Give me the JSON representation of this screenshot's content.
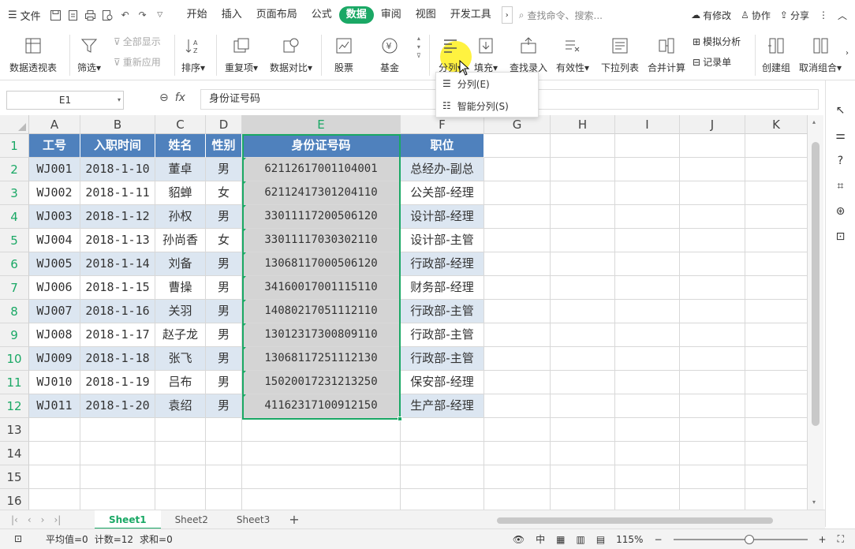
{
  "menubar": {
    "file_label": "文件",
    "tabs": [
      "开始",
      "插入",
      "页面布局",
      "公式",
      "数据",
      "审阅",
      "视图",
      "开发工具"
    ],
    "active_tab": "数据",
    "search_placeholder": "查找命令、搜索...",
    "right": {
      "modify": "有修改",
      "collab": "协作",
      "share": "分享"
    }
  },
  "ribbon": {
    "pivot": "数据透视表",
    "filter": "筛选",
    "show_all": "全部显示",
    "reapply": "重新应用",
    "sort": "排序",
    "dup": "重复项",
    "compare": "数据对比",
    "stock": "股票",
    "fund": "基金",
    "split": "分列",
    "fill": "填充",
    "lookup": "查找录入",
    "validity": "有效性",
    "dropdown_list": "下拉列表",
    "merge_calc": "合并计算",
    "simulate": "模拟分析",
    "record": "记录单",
    "group": "创建组",
    "ungroup": "取消组合"
  },
  "split_menu": {
    "items": [
      "分列(E)",
      "智能分列(S)"
    ]
  },
  "formula": {
    "cell_ref": "E1",
    "content": "身份证号码"
  },
  "columns": [
    "A",
    "B",
    "C",
    "D",
    "E",
    "F",
    "G",
    "H",
    "I",
    "J",
    "K"
  ],
  "rows": [
    "1",
    "2",
    "3",
    "4",
    "5",
    "6",
    "7",
    "8",
    "9",
    "10",
    "11",
    "12",
    "13",
    "14",
    "15",
    "16"
  ],
  "table": {
    "headers": [
      "工号",
      "入职时间",
      "姓名",
      "性别",
      "身份证号码",
      "职位"
    ],
    "data": [
      [
        "WJ001",
        "2018-1-10",
        "董卓",
        "男",
        "62112617001104001",
        "总经办-副总"
      ],
      [
        "WJ002",
        "2018-1-11",
        "貂蝉",
        "女",
        "62112417301204110",
        "公关部-经理"
      ],
      [
        "WJ003",
        "2018-1-12",
        "孙权",
        "男",
        "33011117200506120",
        "设计部-经理"
      ],
      [
        "WJ004",
        "2018-1-13",
        "孙尚香",
        "女",
        "33011117030302110",
        "设计部-主管"
      ],
      [
        "WJ005",
        "2018-1-14",
        "刘备",
        "男",
        "13068117000506120",
        "行政部-经理"
      ],
      [
        "WJ006",
        "2018-1-15",
        "曹操",
        "男",
        "34160017001115110",
        "财务部-经理"
      ],
      [
        "WJ007",
        "2018-1-16",
        "关羽",
        "男",
        "14080217051112110",
        "行政部-主管"
      ],
      [
        "WJ008",
        "2018-1-17",
        "赵子龙",
        "男",
        "13012317300809110",
        "行政部-主管"
      ],
      [
        "WJ009",
        "2018-1-18",
        "张飞",
        "男",
        "13068117251112130",
        "行政部-主管"
      ],
      [
        "WJ010",
        "2018-1-19",
        "吕布",
        "男",
        "15020017231213250",
        "保安部-经理"
      ],
      [
        "WJ011",
        "2018-1-20",
        "袁绍",
        "男",
        "41162317100912150",
        "生产部-经理"
      ]
    ]
  },
  "sheets": [
    "Sheet1",
    "Sheet2",
    "Sheet3"
  ],
  "active_sheet": "Sheet1",
  "status": {
    "avg": "平均值=0",
    "count": "计数=12",
    "sum": "求和=0",
    "zoom": "115%"
  },
  "colors": {
    "accent": "#1aa865",
    "header_blue": "#4f81bd",
    "band": "#dce6f1",
    "highlight": "#fff01e"
  }
}
